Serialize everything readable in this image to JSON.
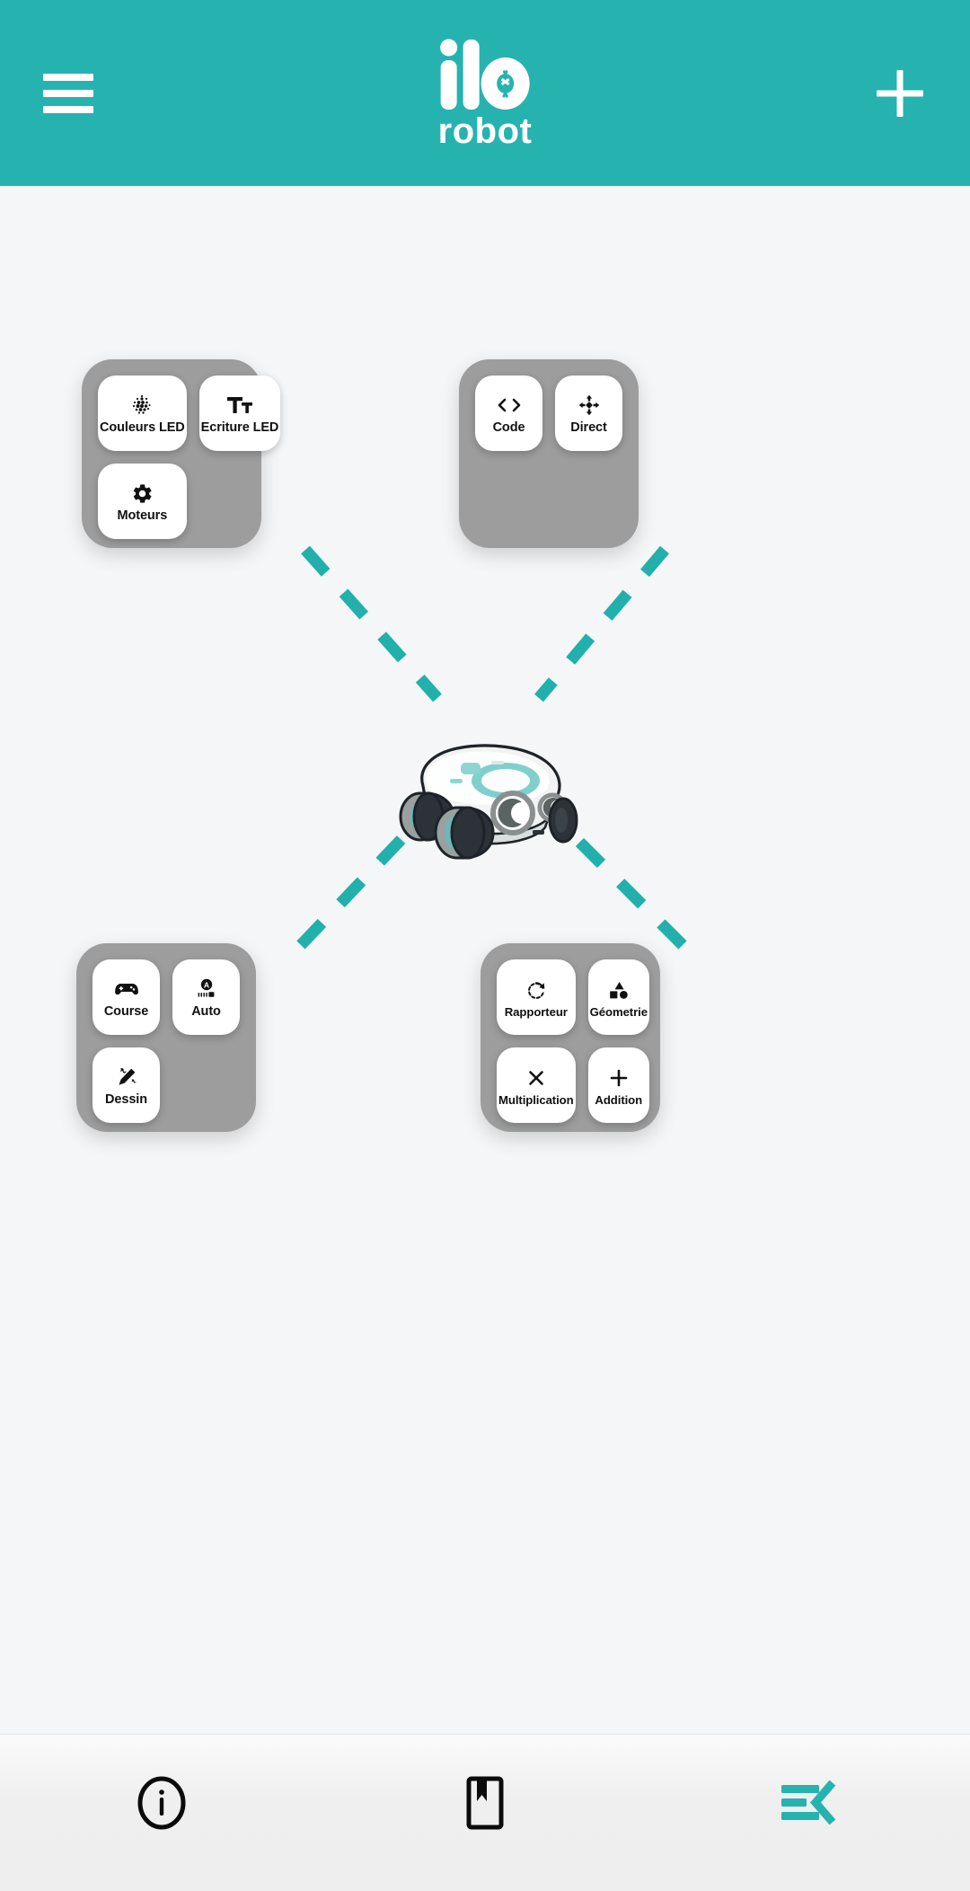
{
  "header": {
    "menu_icon": "hamburger-menu-icon",
    "brand_mark": "ilo-logo-icon",
    "brand_word": "robot",
    "add_icon": "plus-icon",
    "background_color": "#26b3b0"
  },
  "theme": {
    "accent": "#26b3b0",
    "connector_color": "#21b0ac",
    "panel_bg": "#9d9d9d",
    "tile_bg": "#ffffff",
    "page_bg": "#f4f6f8"
  },
  "stage": {
    "robot_label": "ilo-robot-illustration",
    "connector_style": "dashed"
  },
  "panels": [
    {
      "id": "led-panel",
      "position": "top-left",
      "tiles": [
        {
          "label": "Couleurs LED",
          "icon": "led-matrix-dots-icon"
        },
        {
          "label": "Ecriture LED",
          "icon": "text-format-icon"
        },
        {
          "label": "Moteurs",
          "icon": "gear-icon"
        }
      ]
    },
    {
      "id": "control-panel",
      "position": "top-right",
      "tiles": [
        {
          "label": "Code",
          "icon": "code-brackets-icon"
        },
        {
          "label": "Direct",
          "icon": "four-way-arrows-icon"
        }
      ]
    },
    {
      "id": "games-panel",
      "position": "bottom-left",
      "tiles": [
        {
          "label": "Course",
          "icon": "gamepad-icon"
        },
        {
          "label": "Auto",
          "icon": "autonomous-drive-icon"
        },
        {
          "label": "Dessin",
          "icon": "magic-pencil-icon"
        }
      ]
    },
    {
      "id": "math-panel",
      "position": "bottom-right",
      "tiles": [
        {
          "label": "Rapporteur",
          "icon": "rotate-protractor-icon"
        },
        {
          "label": "Géometrie",
          "icon": "shapes-icon"
        },
        {
          "label": "Multiplication",
          "icon": "multiply-icon"
        },
        {
          "label": "Addition",
          "icon": "plus-icon"
        }
      ]
    }
  ],
  "bottom_nav": [
    {
      "id": "info",
      "icon": "info-circle-icon",
      "active": false
    },
    {
      "id": "library",
      "icon": "bookmark-book-icon",
      "active": false
    },
    {
      "id": "menu-collapse",
      "icon": "menu-open-left-icon",
      "active": true
    }
  ]
}
